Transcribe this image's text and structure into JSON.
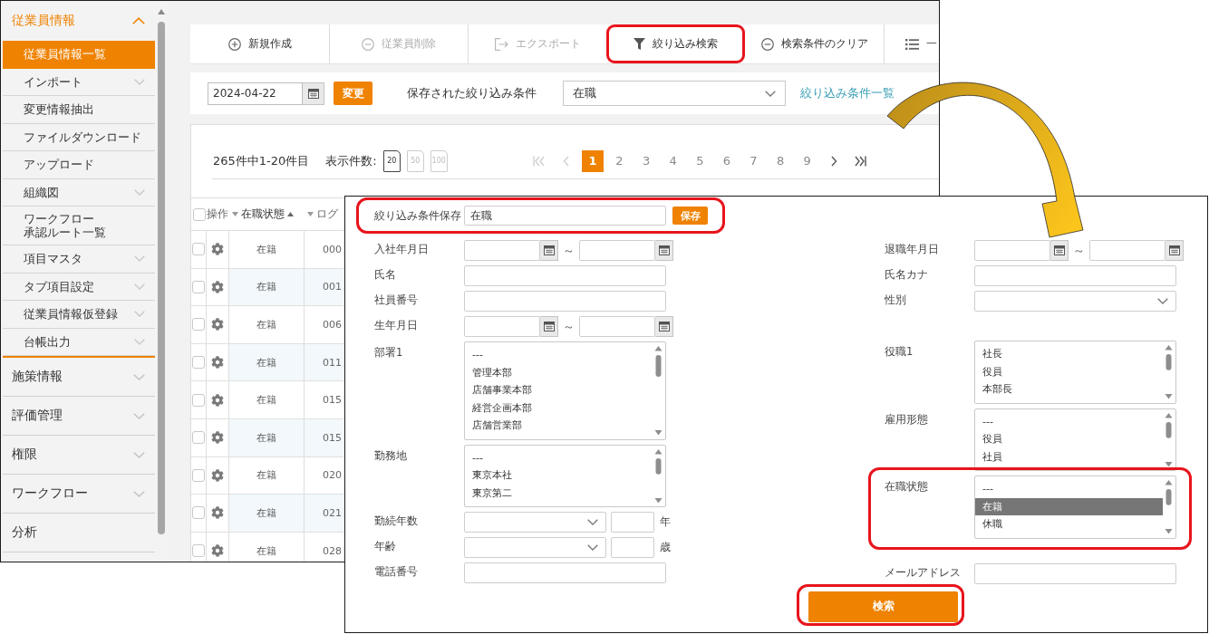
{
  "sidebar": {
    "sections": [
      {
        "label": "従業員情報",
        "expanded": true,
        "items": [
          {
            "label": "従業員情報一覧",
            "selected": true
          },
          {
            "label": "インポート",
            "selected": false,
            "expanded": false
          },
          {
            "label": "変更情報抽出",
            "selected": false
          },
          {
            "label": "ファイルダウンロード",
            "selected": false
          },
          {
            "label": "アップロード",
            "selected": false
          },
          {
            "label": "組織図",
            "selected": false,
            "expanded": false
          },
          {
            "lines": [
              "ワークフロー",
              "承認ルート一覧"
            ],
            "selected": false
          },
          {
            "label": "項目マスタ",
            "selected": false,
            "expanded": false
          },
          {
            "label": "タブ項目設定",
            "selected": false,
            "expanded": false
          },
          {
            "label": "従業員情報仮登録",
            "selected": false,
            "expanded": false
          },
          {
            "label": "台帳出力",
            "selected": false,
            "expanded": false
          }
        ]
      },
      {
        "label": "施策情報",
        "expanded": false
      },
      {
        "label": "評価管理",
        "expanded": false
      },
      {
        "label": "権限",
        "expanded": false
      },
      {
        "label": "ワークフロー",
        "expanded": false
      },
      {
        "label": "分析"
      }
    ]
  },
  "toolbar": {
    "buttons": [
      {
        "kind": "add",
        "label": "新規作成",
        "disabled": false,
        "highlighted": false
      },
      {
        "kind": "remove",
        "label": "従業員削除",
        "disabled": true,
        "highlighted": false
      },
      {
        "kind": "export",
        "label": "エクスポート",
        "disabled": true,
        "highlighted": false
      },
      {
        "kind": "filter",
        "label": "絞り込み検索",
        "disabled": false,
        "highlighted": true
      },
      {
        "kind": "clear",
        "label": "検索条件のクリア",
        "disabled": false,
        "highlighted": false
      },
      {
        "kind": "list",
        "label": "一",
        "disabled": false,
        "highlighted": false
      }
    ]
  },
  "filter_bar": {
    "date": "2024-04-22",
    "change_button": "変更",
    "saved_filter_label": "保存された絞り込み条件",
    "saved_filter": "在職",
    "filter_list_link": "絞り込み条件一覧"
  },
  "pager": {
    "summary": "265件中1-20件目",
    "page_size_label": "表示件数:",
    "page_sizes": [
      {
        "label": "20",
        "selected": true
      },
      {
        "label": "50",
        "selected": false
      },
      {
        "label": "100",
        "selected": false
      }
    ],
    "pages": [
      {
        "label": "1",
        "selected": true
      },
      {
        "label": "2",
        "selected": false
      },
      {
        "label": "3",
        "selected": false
      },
      {
        "label": "4",
        "selected": false
      },
      {
        "label": "5",
        "selected": false
      },
      {
        "label": "6",
        "selected": false
      },
      {
        "label": "7",
        "selected": false
      },
      {
        "label": "8",
        "selected": false
      },
      {
        "label": "9",
        "selected": false
      }
    ]
  },
  "table": {
    "all_checked": false,
    "columns": [
      {
        "label": "操作"
      },
      {
        "label": "在職状態",
        "sorted": true
      },
      {
        "label": "ログ",
        "sorted": false
      }
    ],
    "rows": [
      {
        "checked": false,
        "status": "在籍",
        "login": "000"
      },
      {
        "checked": false,
        "status": "在籍",
        "login": "001"
      },
      {
        "checked": false,
        "status": "在籍",
        "login": "006"
      },
      {
        "checked": false,
        "status": "在籍",
        "login": "011"
      },
      {
        "checked": false,
        "status": "在籍",
        "login": "015"
      },
      {
        "checked": false,
        "status": "在籍",
        "login": "015"
      },
      {
        "checked": false,
        "status": "在籍",
        "login": "020"
      },
      {
        "checked": false,
        "status": "在籍",
        "login": "021"
      },
      {
        "checked": false,
        "status": "在籍",
        "login": "028"
      }
    ]
  },
  "filter_panel": {
    "save": {
      "label": "絞り込み条件保存",
      "value": "在職",
      "button": "保存",
      "highlighted": true
    },
    "left_fields": [
      {
        "kind": "date_range",
        "label": "入社年月日",
        "separator": "～",
        "highlighted": false
      },
      {
        "kind": "text",
        "label": "氏名",
        "highlighted": false
      },
      {
        "kind": "text",
        "label": "社員番号",
        "highlighted": false
      },
      {
        "kind": "date_range",
        "label": "生年月日",
        "separator": "～",
        "highlighted": false
      },
      {
        "kind": "listbox",
        "label": "部署1",
        "highlighted": false,
        "options": [
          {
            "label": "---",
            "selected": false
          },
          {
            "label": "管理本部",
            "selected": false
          },
          {
            "label": "店舗事業本部",
            "selected": false
          },
          {
            "label": "経営企画本部",
            "selected": false
          },
          {
            "label": "店舗営業部",
            "selected": false
          }
        ]
      },
      {
        "kind": "listbox",
        "label": "勤務地",
        "highlighted": false,
        "options": [
          {
            "label": "---",
            "selected": false
          },
          {
            "label": "東京本社",
            "selected": false
          },
          {
            "label": "東京第二",
            "selected": false
          }
        ]
      },
      {
        "kind": "select_number",
        "label": "勤続年数",
        "unit": "年",
        "highlighted": false
      },
      {
        "kind": "select_number",
        "label": "年齢",
        "unit": "歳",
        "highlighted": false
      },
      {
        "kind": "text",
        "label": "電話番号",
        "highlighted": false
      }
    ],
    "right_fields": [
      {
        "kind": "date_range",
        "label": "退職年月日",
        "separator": "～",
        "highlighted": false
      },
      {
        "kind": "text",
        "label": "氏名カナ",
        "highlighted": false
      },
      {
        "kind": "select",
        "label": "性別",
        "highlighted": false
      },
      {
        "kind": "listbox",
        "label": "役職1",
        "highlighted": false,
        "options": [
          {
            "label": "社長",
            "selected": false
          },
          {
            "label": "役員",
            "selected": false
          },
          {
            "label": "本部長",
            "selected": false
          }
        ]
      },
      {
        "kind": "listbox",
        "label": "雇用形態",
        "highlighted": false,
        "options": [
          {
            "label": "---",
            "selected": false
          },
          {
            "label": "役員",
            "selected": false
          },
          {
            "label": "社員",
            "selected": false
          }
        ]
      },
      {
        "kind": "listbox",
        "label": "在職状態",
        "highlighted": true,
        "options": [
          {
            "label": "---",
            "selected": false
          },
          {
            "label": "在籍",
            "selected": true
          },
          {
            "label": "休職",
            "selected": false
          }
        ]
      },
      {
        "kind": "text",
        "label": "メールアドレス",
        "highlighted": false
      }
    ],
    "search_button": {
      "label": "検索",
      "highlighted": true
    }
  }
}
